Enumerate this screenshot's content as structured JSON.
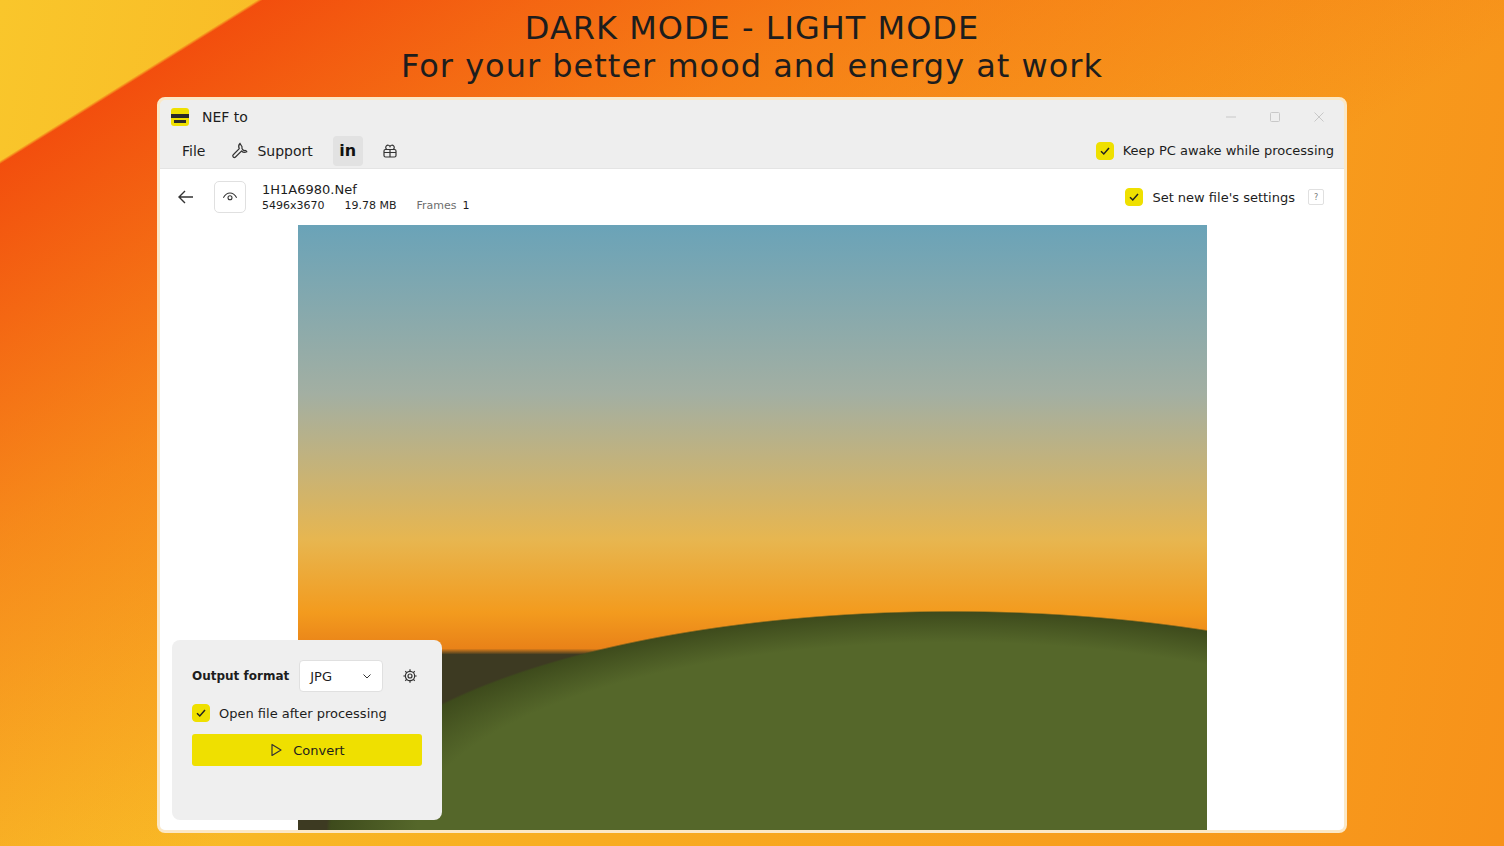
{
  "headline": [
    "DARK MODE - LIGHT MODE",
    "For your better mood and energy at work"
  ],
  "window": {
    "title": "NEF to"
  },
  "menu": [
    {
      "label": "File",
      "kind": "text"
    },
    {
      "label": "Support",
      "kind": "wrench"
    }
  ],
  "linkedin": {
    "label": "in"
  },
  "keep_awake": {
    "label": "Keep PC awake while processing",
    "checked": true
  },
  "file": {
    "name": "1H1A6980.Nef",
    "dimensions": "5496x3670",
    "size": "19.78 MB",
    "frames_label": "Frames",
    "frames": "1"
  },
  "new_file_settings": {
    "label": "Set new file's settings",
    "checked": true,
    "help": "?"
  },
  "output": {
    "label": "Output format",
    "value": "JPG"
  },
  "open_after": {
    "label": "Open file after processing",
    "checked": true
  },
  "convert": {
    "label": "Convert"
  }
}
